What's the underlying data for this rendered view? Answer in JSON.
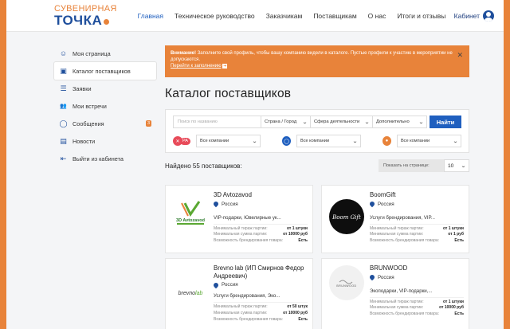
{
  "header": {
    "logo_line1": "СУВЕНИРНАЯ",
    "logo_line2": "ТОЧКА",
    "nav": [
      "Главная",
      "Техническое руководство",
      "Заказчикам",
      "Поставщикам",
      "О нас",
      "Итоги и отзывы"
    ],
    "cabinet": "Кабинет"
  },
  "sidebar": {
    "items": [
      {
        "label": "Моя страница",
        "icon": "user-circle-icon",
        "glyph": "☺"
      },
      {
        "label": "Каталог поставщиков",
        "icon": "catalog-icon",
        "glyph": "▣"
      },
      {
        "label": "Заявки",
        "icon": "list-icon",
        "glyph": "☰"
      },
      {
        "label": "Мои встречи",
        "icon": "people-icon",
        "glyph": "👥"
      },
      {
        "label": "Сообщения",
        "icon": "chat-icon",
        "glyph": "◯",
        "badge": "3"
      },
      {
        "label": "Новости",
        "icon": "news-icon",
        "glyph": "▤"
      },
      {
        "label": "Выйти из кабинета",
        "icon": "logout-icon",
        "glyph": "⇤"
      }
    ]
  },
  "alert": {
    "strong": "Внимание!",
    "text": " Заполните свой профиль, чтобы вашу компанию видели в каталоге. Пустые профили к участию в мероприятии не допускаются.",
    "link": "Перейти к заполнению"
  },
  "page_title": "Каталог поставщиков",
  "filters": {
    "search_placeholder": "Поиск по названию",
    "city": "Страна / Город",
    "activity": "Сфера деятельности",
    "extra": "Дополнительно",
    "button": "Найти",
    "tag_label": "РА",
    "select1": "Все компании",
    "select2": "Все компании",
    "select3": "Все компании"
  },
  "results": {
    "found": "Найдено 55 поставщиков:",
    "per_page_label": "Показать на странице:",
    "per_page_value": "10"
  },
  "stat_labels": {
    "min_run": "Минимальный тираж партии:",
    "min_sum": "Минимальная сумма партии:",
    "branding": "Возможность брендирования товара:"
  },
  "cards": [
    {
      "name": "3D Avtozavod",
      "country": "Россия",
      "cats": "VIP-подарки, Ювелирные ук...",
      "min_run": "от 1 штуки",
      "min_sum": "от 10000 руб",
      "branding": "Есть",
      "logo_text": "3D Avtozavod"
    },
    {
      "name": "BoomGift",
      "country": "Россия",
      "cats": "Услуги брендирования, VIP...",
      "min_run": "от 1 штуки",
      "min_sum": "от 1 руб",
      "branding": "Есть",
      "logo_text": "BoomGift"
    },
    {
      "name": "Brevno lab (ИП Смирнов Федор Андреевич)",
      "country": "Россия",
      "cats": "Услуги брендирования, Эко...",
      "min_run": "от 50 штук",
      "min_sum": "от 10000 руб",
      "branding": "Есть",
      "logo_text": "brevnolab"
    },
    {
      "name": "BRUNWOOD",
      "country": "Россия",
      "cats": "Экоподарки, VIP-подарки,...",
      "min_run": "от 1 штуки",
      "min_sum": "от 10000 руб",
      "branding": "Есть",
      "logo_text": "BRUNWOOD"
    }
  ]
}
